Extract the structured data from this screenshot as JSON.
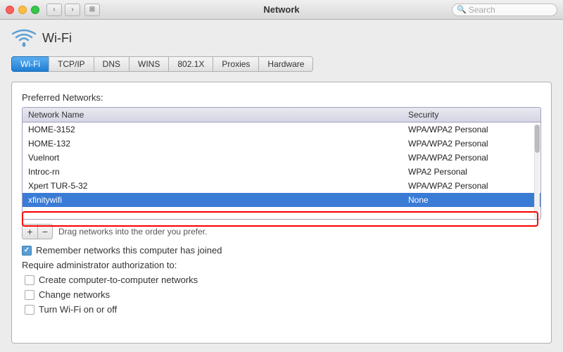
{
  "titlebar": {
    "title": "Network",
    "search_placeholder": "Search",
    "back_label": "‹",
    "forward_label": "›",
    "grid_label": "⊞"
  },
  "wifi": {
    "icon": "wifi",
    "title": "Wi-Fi"
  },
  "tabs": [
    {
      "id": "wifi",
      "label": "Wi-Fi",
      "active": true
    },
    {
      "id": "tcpip",
      "label": "TCP/IP",
      "active": false
    },
    {
      "id": "dns",
      "label": "DNS",
      "active": false
    },
    {
      "id": "wins",
      "label": "WINS",
      "active": false
    },
    {
      "id": "8021x",
      "label": "802.1X",
      "active": false
    },
    {
      "id": "proxies",
      "label": "Proxies",
      "active": false
    },
    {
      "id": "hardware",
      "label": "Hardware",
      "active": false
    }
  ],
  "preferred_networks_label": "Preferred Networks:",
  "table": {
    "col_name": "Network Name",
    "col_security": "Security",
    "rows": [
      {
        "name": "HOME-3152",
        "security": "WPA/WPA2 Personal",
        "selected": false
      },
      {
        "name": "HOME-132",
        "security": "WPA/WPA2 Personal",
        "selected": false
      },
      {
        "name": "Vuelnort",
        "security": "WPA/WPA2 Personal",
        "selected": false
      },
      {
        "name": "Introc-rn",
        "security": "WPA2 Personal",
        "selected": false
      },
      {
        "name": "Xpert TUR-5-32",
        "security": "WPA/WPA2 Personal",
        "selected": false
      },
      {
        "name": "xfinitywifi",
        "security": "None",
        "selected": true
      }
    ]
  },
  "controls": {
    "add_label": "+",
    "remove_label": "−",
    "drag_hint": "Drag networks into the order you prefer."
  },
  "checkboxes": [
    {
      "id": "remember",
      "checked": true,
      "label": "Remember networks this computer has joined"
    }
  ],
  "require_label": "Require administrator authorization to:",
  "sub_checkboxes": [
    {
      "id": "computer_to_computer",
      "checked": false,
      "label": "Create computer-to-computer networks"
    },
    {
      "id": "change_networks",
      "checked": false,
      "label": "Change networks"
    },
    {
      "id": "turn_wifi",
      "checked": false,
      "label": "Turn Wi-Fi on or off"
    }
  ],
  "colors": {
    "tab_active_bg": "#3a7bd5",
    "selected_row_bg": "#3a7bd5",
    "red": "#e00000"
  }
}
